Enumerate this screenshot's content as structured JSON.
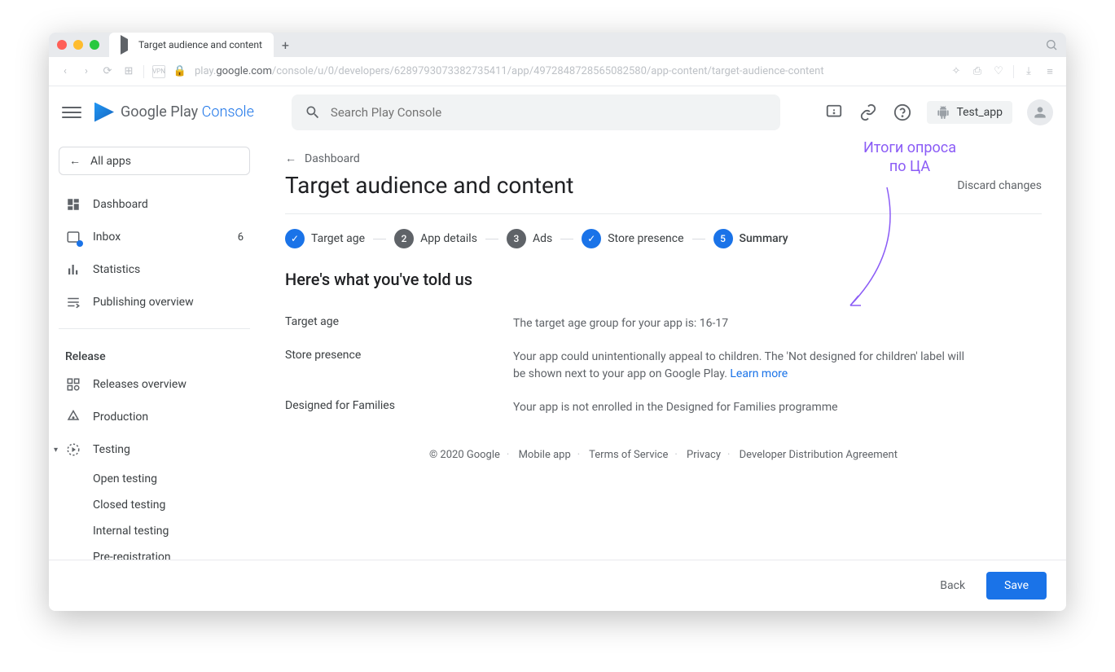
{
  "browser": {
    "tab_title": "Target audience and content",
    "url_prefix": "play.",
    "url_host": "google.com",
    "url_path": "/console/u/0/developers/6289793073382735411/app/4972848728565082580/app-content/target-audience-content"
  },
  "header": {
    "logo_main": "Google Play",
    "logo_sub": "Console",
    "search_placeholder": "Search Play Console",
    "app_name": "Test_app"
  },
  "sidebar": {
    "all_apps": "All apps",
    "items_top": [
      {
        "icon": "dashboard",
        "label": "Dashboard"
      },
      {
        "icon": "inbox",
        "label": "Inbox",
        "badge": "6"
      },
      {
        "icon": "stats",
        "label": "Statistics"
      },
      {
        "icon": "publish",
        "label": "Publishing overview"
      }
    ],
    "section_release": "Release",
    "items_release": [
      {
        "icon": "releases",
        "label": "Releases overview"
      },
      {
        "icon": "production",
        "label": "Production"
      },
      {
        "icon": "testing",
        "label": "Testing",
        "expandable": true
      }
    ],
    "testing_sub": [
      "Open testing",
      "Closed testing",
      "Internal testing",
      "Pre-registration"
    ]
  },
  "main": {
    "breadcrumb": "Dashboard",
    "title": "Target audience and content",
    "discard": "Discard changes",
    "steps": [
      {
        "type": "done",
        "label": "Target age"
      },
      {
        "type": "num",
        "num": "2",
        "label": "App details"
      },
      {
        "type": "num",
        "num": "3",
        "label": "Ads"
      },
      {
        "type": "done",
        "label": "Store presence"
      },
      {
        "type": "current",
        "num": "5",
        "label": "Summary"
      }
    ],
    "section_title": "Here's what you've told us",
    "rows": [
      {
        "label": "Target age",
        "value": "The target age group for your app is: 16-17"
      },
      {
        "label": "Store presence",
        "value": "Your app could unintentionally appeal to children. The 'Not designed for children' label will be shown next to your app on Google Play.",
        "link": "Learn more"
      },
      {
        "label": "Designed for Families",
        "value": "Your app is not enrolled in the Designed for Families programme"
      }
    ]
  },
  "annotation": {
    "line1": "Итоги опроса",
    "line2": "по ЦА"
  },
  "footer": {
    "copyright": "© 2020 Google",
    "links": [
      "Mobile app",
      "Terms of Service",
      "Privacy",
      "Developer Distribution Agreement"
    ]
  },
  "actions": {
    "back": "Back",
    "save": "Save"
  }
}
